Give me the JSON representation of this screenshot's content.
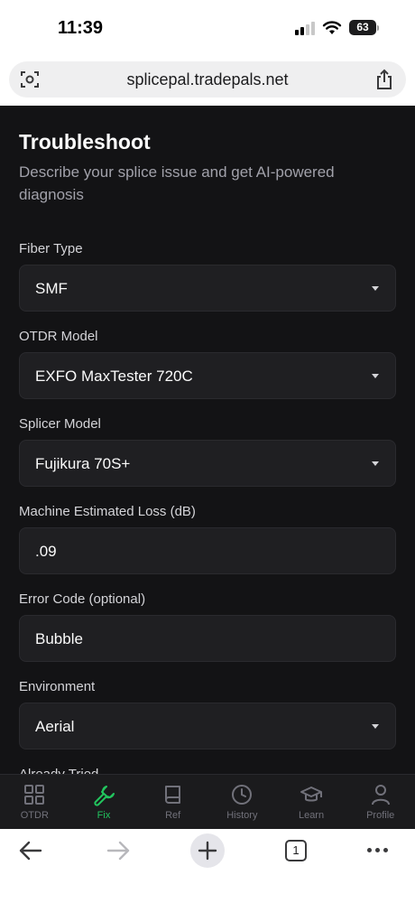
{
  "status_bar": {
    "time": "11:39",
    "battery": "63"
  },
  "browser": {
    "url": "splicepal.tradepals.net",
    "open_tabs": "1"
  },
  "page": {
    "title": "Troubleshoot",
    "subtitle": "Describe your splice issue and get AI-powered diagnosis"
  },
  "form": {
    "fiber_type": {
      "label": "Fiber Type",
      "value": "SMF"
    },
    "otdr_model": {
      "label": "OTDR Model",
      "value": "EXFO MaxTester 720C"
    },
    "splicer_model": {
      "label": "Splicer Model",
      "value": "Fujikura 70S+"
    },
    "estimated_loss": {
      "label": "Machine Estimated Loss (dB)",
      "value": ".09"
    },
    "error_code": {
      "label": "Error Code (optional)",
      "value": "Bubble"
    },
    "environment": {
      "label": "Environment",
      "value": "Aerial"
    },
    "already_tried": {
      "label": "Already Tried"
    }
  },
  "tabs": [
    {
      "label": "OTDR",
      "icon": "grid-icon"
    },
    {
      "label": "Fix",
      "icon": "wrench-icon",
      "active": true
    },
    {
      "label": "Ref",
      "icon": "book-icon"
    },
    {
      "label": "History",
      "icon": "clock-icon"
    },
    {
      "label": "Learn",
      "icon": "graduation-cap-icon"
    },
    {
      "label": "Profile",
      "icon": "user-icon"
    }
  ],
  "colors": {
    "accent": "#22c55e",
    "background": "#131315",
    "field": "#1f1f22"
  }
}
